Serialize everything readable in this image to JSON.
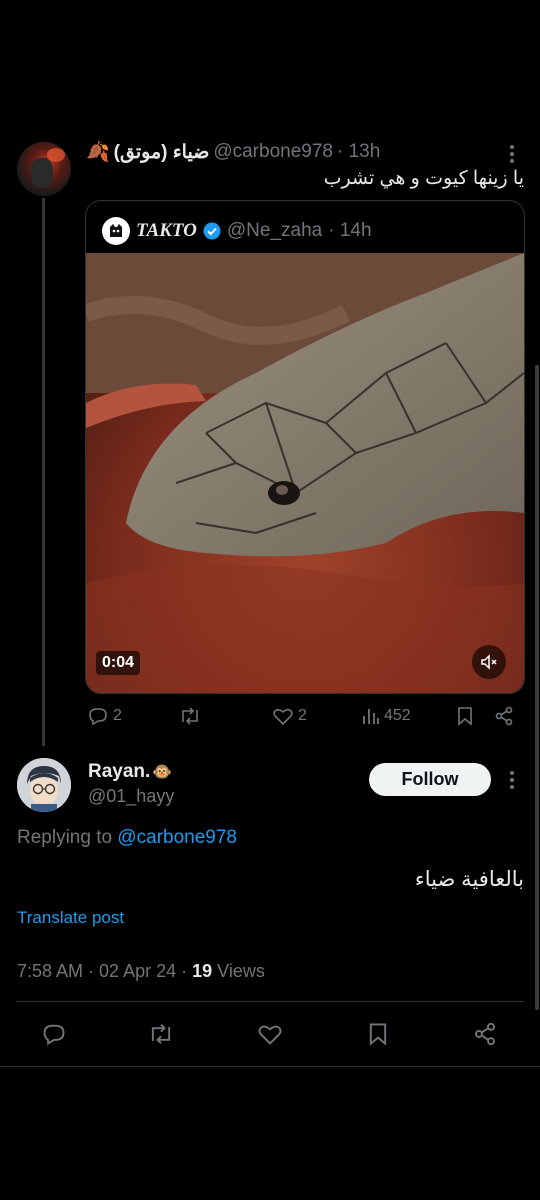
{
  "quoting_tweet": {
    "author_name": "ضياء (موتق)",
    "author_emoji": "🍂",
    "handle": "@carbone978",
    "time": "· 13h",
    "text": "يا زينها كيوت و هي تشرب",
    "quoted": {
      "author_name": "TAKTO",
      "handle": "@Ne_zaha",
      "time": "· 14h",
      "video_duration": "0:04"
    },
    "actions": {
      "replies": "2",
      "likes": "2",
      "views": "452"
    }
  },
  "main_tweet": {
    "author_name": "Rayan.",
    "author_emoji": "🐵",
    "handle": "@01_hayy",
    "follow_label": "Follow",
    "replying_prefix": "Replying to",
    "replying_to": "@carbone978",
    "text": "بالعافية ضياء",
    "translate_label": "Translate post",
    "timestamp": "7:58 AM · 02 Apr 24 · ",
    "views_count": "19",
    "views_label": "Views"
  },
  "colors": {
    "background": "#000000",
    "accent": "#1d9bf0",
    "muted": "#71767b",
    "text": "#e7e9ea"
  }
}
